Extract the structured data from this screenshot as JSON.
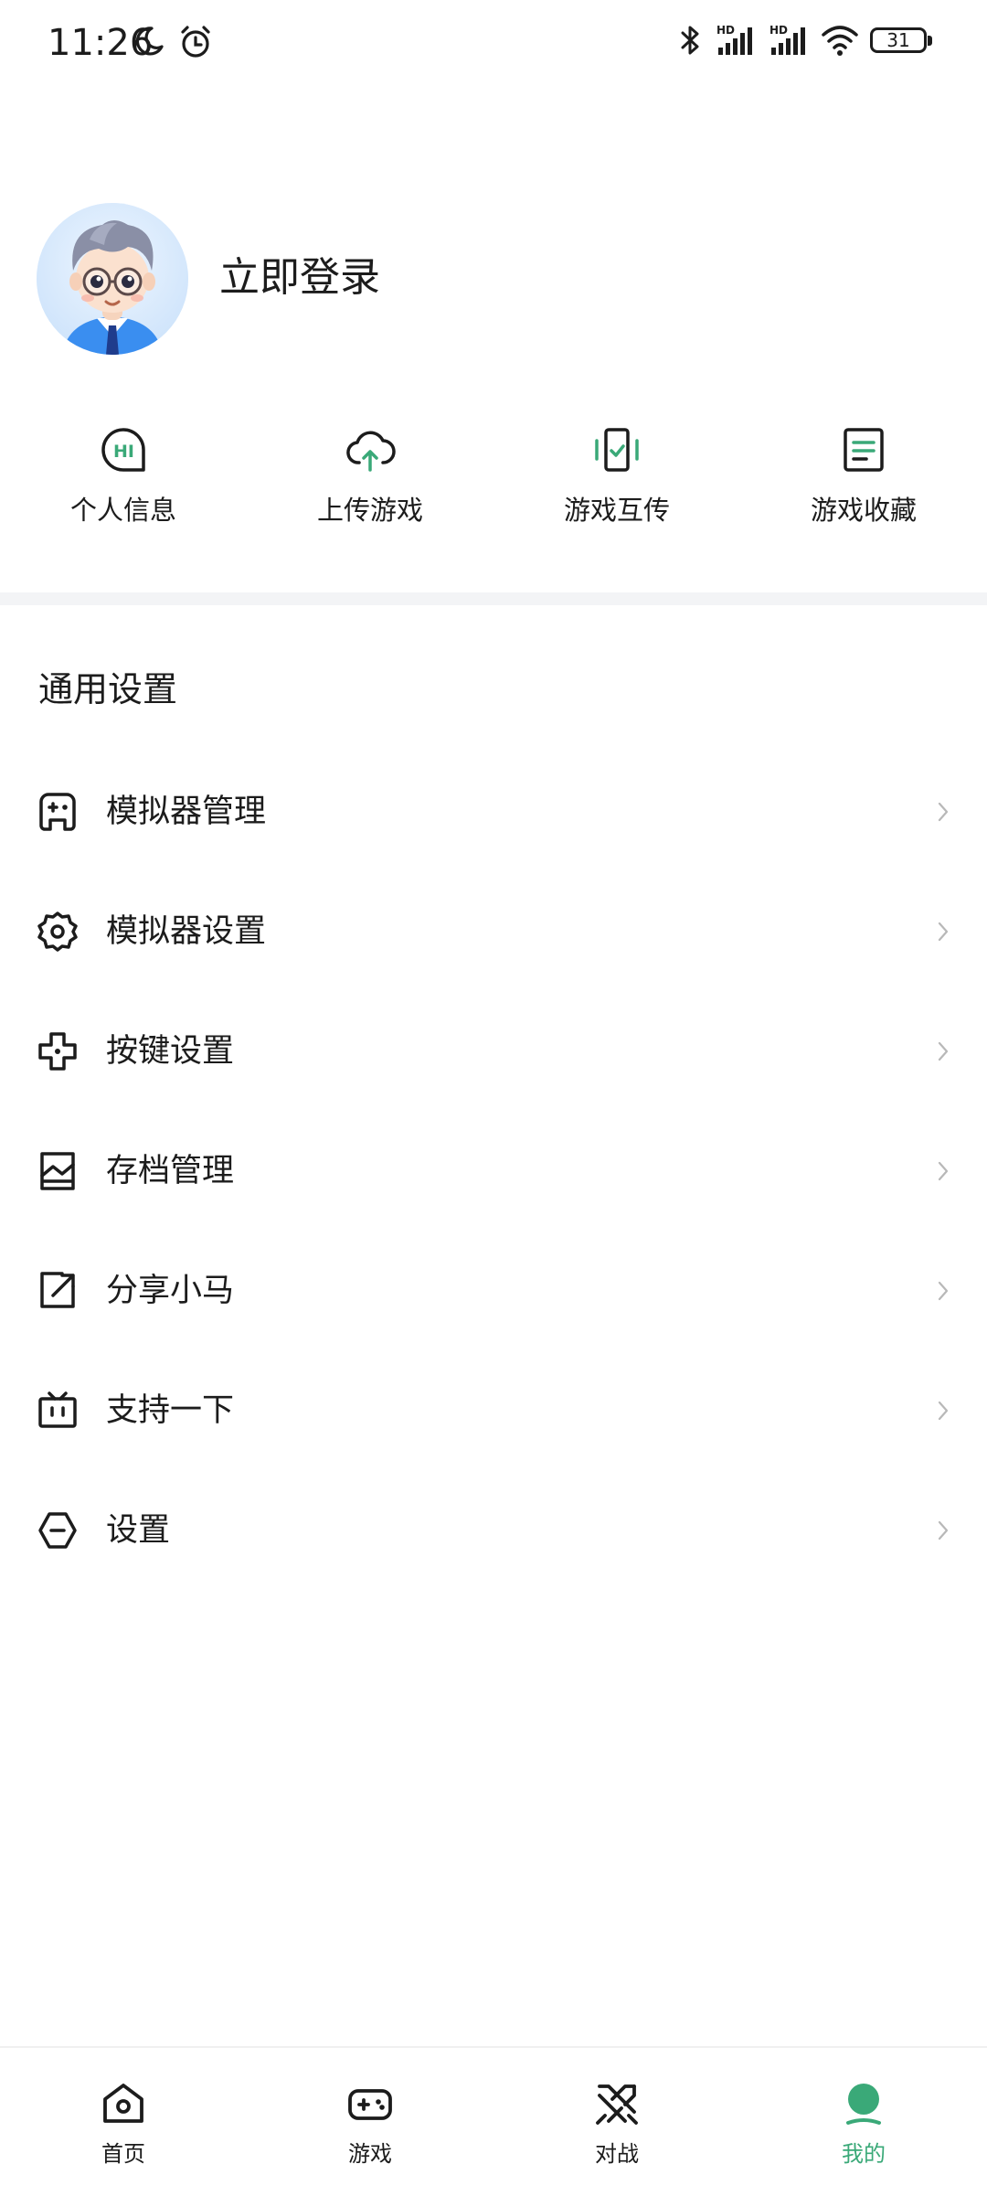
{
  "status_bar": {
    "time": "11:26",
    "battery": "31",
    "left_icons": [
      "moon-icon",
      "alarm-icon"
    ],
    "right_icons": [
      "bluetooth-icon",
      "hd-signal-icon",
      "hd-signal-icon",
      "wifi-icon",
      "battery-icon"
    ]
  },
  "profile": {
    "login_label": "立即登录",
    "avatar_icon": "cartoon-avatar-icon"
  },
  "shortcuts": [
    {
      "label": "个人信息",
      "icon": "hi-chat-bubble-icon"
    },
    {
      "label": "上传游戏",
      "icon": "cloud-upload-icon"
    },
    {
      "label": "游戏互传",
      "icon": "phone-transfer-icon"
    },
    {
      "label": "游戏收藏",
      "icon": "document-list-icon"
    }
  ],
  "general_settings": {
    "title": "通用设置",
    "items": [
      {
        "label": "模拟器管理",
        "icon": "gamepad-icon"
      },
      {
        "label": "模拟器设置",
        "icon": "gear-icon"
      },
      {
        "label": "按键设置",
        "icon": "dpad-icon"
      },
      {
        "label": "存档管理",
        "icon": "archive-icon"
      },
      {
        "label": "分享小马",
        "icon": "share-icon"
      },
      {
        "label": "支持一下",
        "icon": "tv-icon"
      },
      {
        "label": "设置",
        "icon": "settings-hexagon-icon"
      }
    ]
  },
  "bottom_nav": {
    "items": [
      {
        "label": "首页",
        "icon": "home-icon",
        "active": false
      },
      {
        "label": "游戏",
        "icon": "gamepad-icon",
        "active": false
      },
      {
        "label": "对战",
        "icon": "crossed-swords-icon",
        "active": false
      },
      {
        "label": "我的",
        "icon": "profile-icon",
        "active": true
      }
    ]
  },
  "colors": {
    "accent": "#3aa978",
    "text": "#1c1c1c",
    "chevron": "#b8b8b8",
    "divider": "#f3f4f6"
  }
}
